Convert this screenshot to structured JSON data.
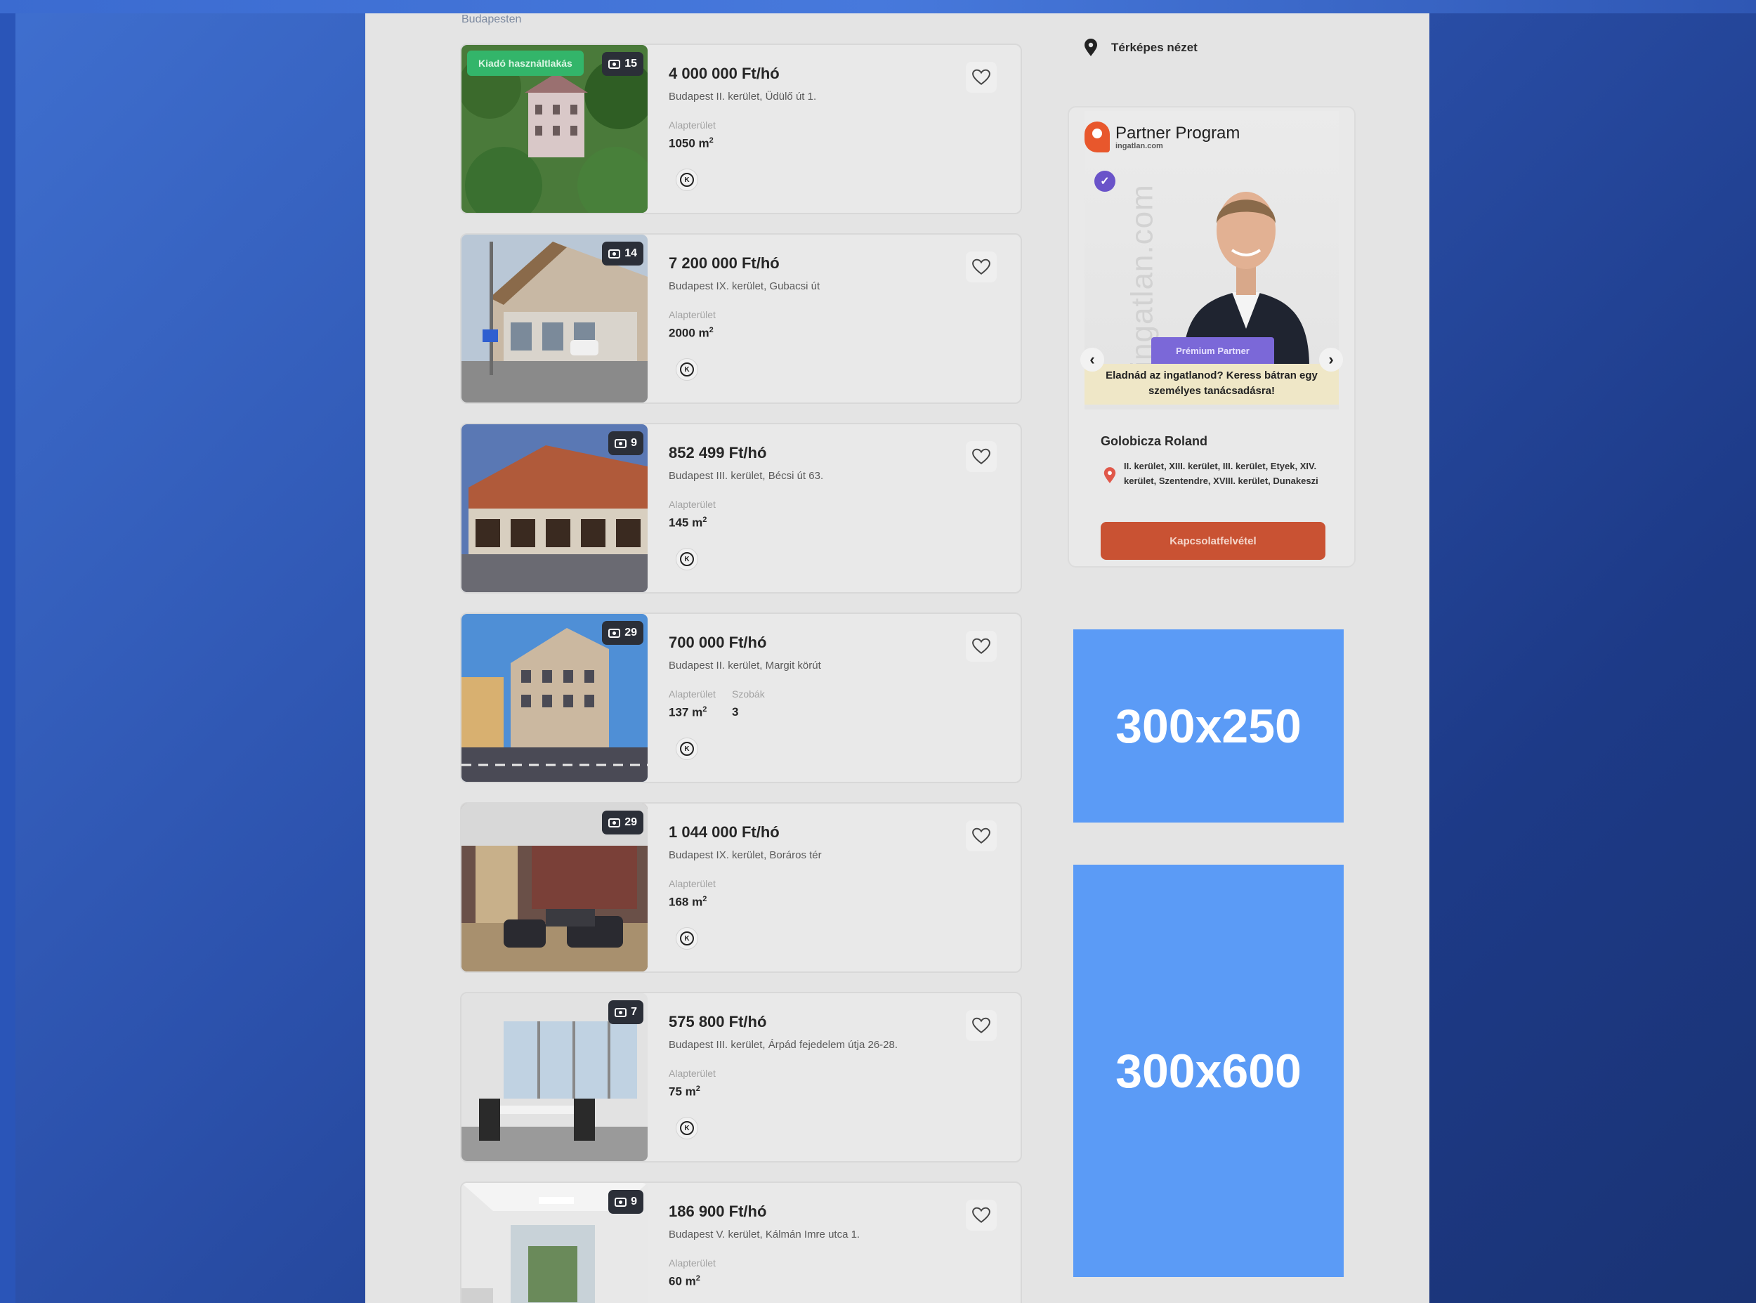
{
  "breadcrumb": "Budapesten",
  "listings": [
    {
      "price": "4 000 000 Ft/hó",
      "address": "Budapest II. kerület, Üdülő út 1.",
      "attr1_label": "Alapterület",
      "attr1_value": "1050 m",
      "photos": "15",
      "tag": "Kiadó használtlakás"
    },
    {
      "price": "7 200 000 Ft/hó",
      "address": "Budapest IX. kerület, Gubacsi út",
      "attr1_label": "Alapterület",
      "attr1_value": "2000 m",
      "photos": "14"
    },
    {
      "price": "852 499 Ft/hó",
      "address": "Budapest III. kerület, Bécsi út 63.",
      "attr1_label": "Alapterület",
      "attr1_value": "145 m",
      "photos": "9"
    },
    {
      "price": "700 000 Ft/hó",
      "address": "Budapest II. kerület, Margit körút",
      "attr1_label": "Alapterület",
      "attr1_value": "137 m",
      "attr2_label": "Szobák",
      "attr2_value": "3",
      "photos": "29"
    },
    {
      "price": "1 044 000 Ft/hó",
      "address": "Budapest IX. kerület, Boráros tér",
      "attr1_label": "Alapterület",
      "attr1_value": "168 m",
      "photos": "29"
    },
    {
      "price": "575 800 Ft/hó",
      "address": "Budapest III. kerület, Árpád fejedelem útja 26-28.",
      "attr1_label": "Alapterület",
      "attr1_value": "75 m",
      "photos": "7"
    },
    {
      "price": "186 900 Ft/hó",
      "address": "Budapest V. kerület, Kálmán Imre utca 1.",
      "attr1_label": "Alapterület",
      "attr1_value": "60 m",
      "photos": "9"
    }
  ],
  "sidebar": {
    "map_view": "Térképes nézet",
    "partner_program": {
      "title": "Partner Program",
      "subtitle": "ingatlan.com",
      "vertical_brand": "ingatlan.com",
      "premium_tag": "Prémium Partner",
      "note": "Eladnád az ingatlanod? Keress bátran egy személyes tanácsadásra!",
      "agent_name": "Golobicza Roland",
      "areas": "II. kerület, XIII. kerület, III. kerület, Etyek, XIV. kerület, Szentendre, XVIII. kerület, Dunakeszi",
      "contact_label": "Kapcsolatfelvétel"
    },
    "ad1": "300x250",
    "ad2": "300x600"
  },
  "colors": {
    "ad_blue": "#5b9bf6",
    "contact_orange": "#c95233",
    "premium_purple": "#7b68d8",
    "tag_green": "#33b56a"
  }
}
